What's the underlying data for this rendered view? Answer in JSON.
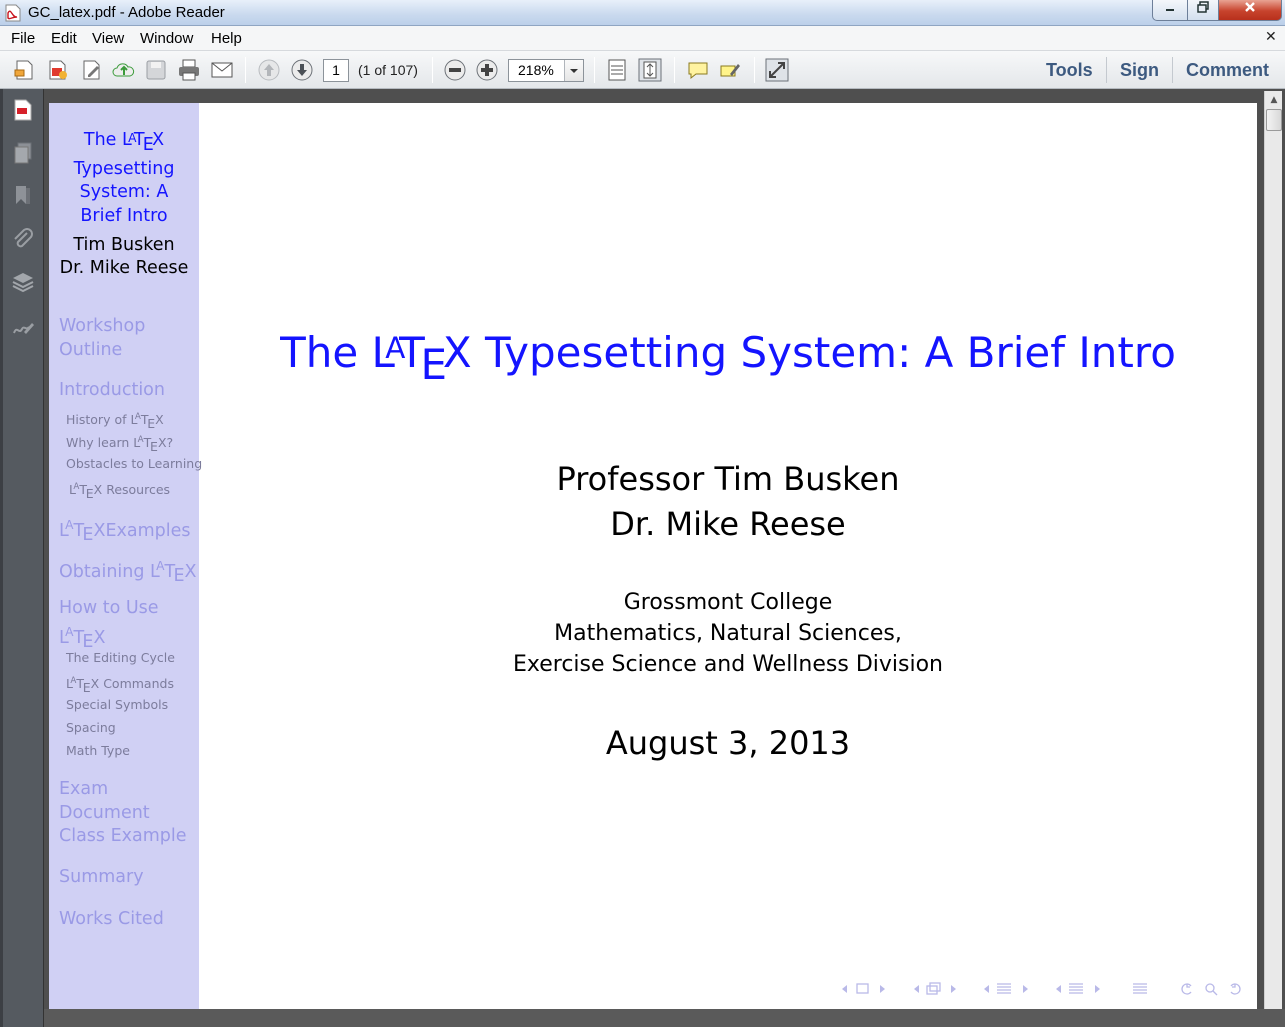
{
  "window": {
    "title": "GC_latex.pdf - Adobe Reader"
  },
  "menu": {
    "items": [
      "File",
      "Edit",
      "View",
      "Window",
      "Help"
    ]
  },
  "toolbar": {
    "page_number": "1",
    "page_count": "(1 of 107)",
    "zoom": "218%",
    "tools_label": "Tools",
    "sign_label": "Sign",
    "comment_label": "Comment"
  },
  "sidebar": {
    "title_lines": [
      "The ",
      "Typesetting",
      "System: A",
      "Brief Intro"
    ],
    "authors": [
      "Tim Busken",
      "Dr. Mike Reese"
    ],
    "sections": {
      "workshop": [
        "Workshop",
        "Outline"
      ],
      "introduction": "Introduction",
      "intro_subs": {
        "history_prefix": "History of ",
        "why_prefix": "Why learn ",
        "why_suffix": "?",
        "obstacles": "Obstacles to Learning",
        "resources_suffix": " Resources"
      },
      "examples_suffix": "Examples",
      "obtaining_prefix": "Obtaining ",
      "how_to_use": "How to Use",
      "use_subs": {
        "editing": "The Editing Cycle",
        "commands_suffix": " Commands",
        "symbols": "Special Symbols",
        "spacing": "Spacing",
        "math": "Math Type"
      },
      "exam": [
        "Exam",
        "Document",
        "Class Example"
      ],
      "summary": "Summary",
      "works_cited": "Works Cited"
    }
  },
  "slide": {
    "title_prefix": "The ",
    "title_suffix": " Typesetting System: A Brief Intro",
    "authors": [
      "Professor Tim Busken",
      "Dr. Mike Reese"
    ],
    "institution": [
      "Grossmont College",
      "Mathematics, Natural Sciences,",
      "Exercise Science and Wellness Division"
    ],
    "date": "August 3, 2013"
  },
  "colors": {
    "title_blue": "#1414ff",
    "sidebar_bg": "#d0d0f4",
    "section_gray": "#9a9ae6"
  }
}
